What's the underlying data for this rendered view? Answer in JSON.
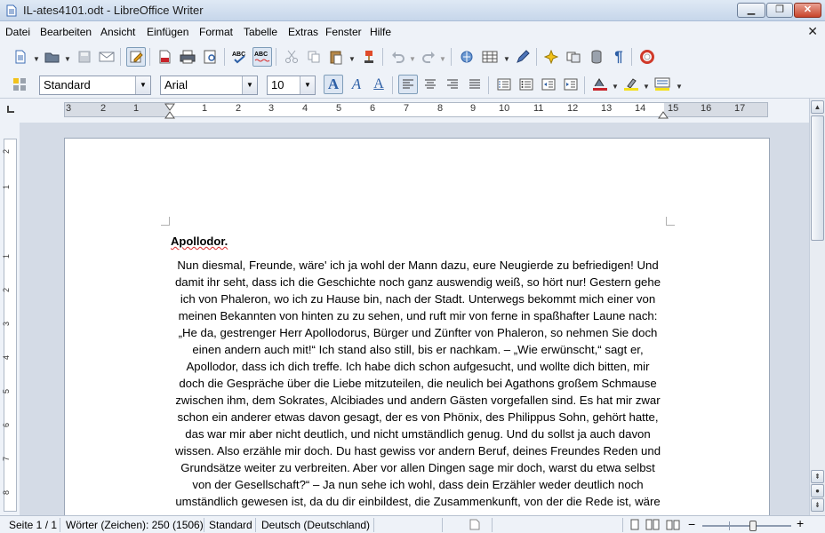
{
  "window": {
    "title": "IL-ates4101.odt - LibreOffice Writer",
    "minimize": "▁",
    "maximize": "❐",
    "close": "✕"
  },
  "menu": {
    "items": [
      "Datei",
      "Bearbeiten",
      "Ansicht",
      "Einfügen",
      "Format",
      "Tabelle",
      "Extras",
      "Fenster",
      "Hilfe"
    ],
    "doc_close": "✕"
  },
  "formatting": {
    "style": "Standard",
    "font": "Arial",
    "size": "10"
  },
  "ruler": {
    "numbers": [
      "3",
      "2",
      "1",
      "1",
      "2",
      "3",
      "4",
      "5",
      "6",
      "7",
      "8",
      "9",
      "10",
      "11",
      "12",
      "13",
      "14",
      "15",
      "16",
      "17"
    ],
    "vnumbers": [
      "2",
      "1",
      "1",
      "2",
      "3",
      "4",
      "5",
      "6",
      "7",
      "8"
    ]
  },
  "document": {
    "heading": "Apollodor.",
    "lines": [
      "Nun diesmal, Freunde, wäre' ich ja wohl der Mann dazu, eure Neugierde zu befriedigen! Und",
      "damit ihr seht, dass ich die Geschichte noch ganz auswendig weiß, so hört nur! Gestern gehe",
      "ich von Phaleron, wo ich zu Hause bin, nach der Stadt. Unterwegs bekommt mich einer von",
      "meinen Bekannten von hinten zu zu sehen, und ruft mir von ferne in spaßhafter Laune nach:",
      "„He da, gestrenger Herr Apollodorus, Bürger und Zünfter von Phaleron, so nehmen Sie doch",
      "einen andern auch mit!“ Ich stand also still, bis er nachkam. – „Wie erwünscht,“ sagt er,",
      "Apollodor, dass ich dich treffe. Ich habe dich schon aufgesucht, und wollte dich bitten, mir",
      "doch die Gespräche über die Liebe mitzuteilen, die neulich bei Agathons großem Schmause",
      "zwischen ihm, dem Sokrates, Alcibiades und andern Gästen vorgefallen sind. Es hat mir zwar",
      "schon ein anderer etwas davon gesagt, der es von Phönix, des Philippus Sohn, gehört hatte,",
      "das war mir aber nicht deutlich, und nicht umständlich genug. Und du sollst ja auch davon",
      "wissen. Also erzähle mir doch. Du hast gewiss vor andern Beruf, deines Freundes Reden und",
      "Grundsätze weiter zu verbreiten. Aber vor allen Dingen sage mir doch, warst du etwa selbst",
      "von der Gesellschaft?“ – Ja nun sehe ich wohl, dass dein Erzähler weder deutlich noch",
      "umständlich gewesen ist, da du dir einbildest, die Zusammenkunft, von der die Rede ist, wäre"
    ]
  },
  "status": {
    "page": "Seite 1 / 1",
    "words": "Wörter (Zeichen): 250 (1506)",
    "style": "Standard",
    "language": "Deutsch (Deutschland)"
  }
}
